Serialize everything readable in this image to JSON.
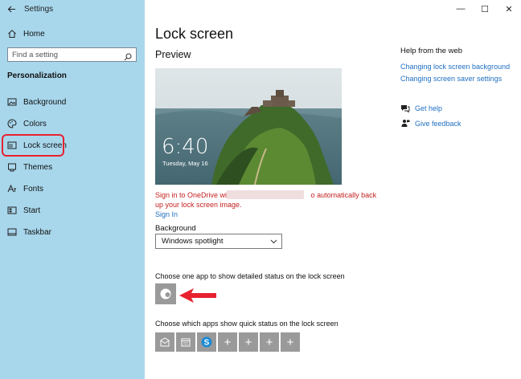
{
  "window": {
    "title": "Settings",
    "controls": {
      "minimize": "—",
      "maximize": "☐",
      "close": "✕"
    }
  },
  "sidebar": {
    "home_label": "Home",
    "search_placeholder": "Find a setting",
    "section_title": "Personalization",
    "items": [
      {
        "label": "Background",
        "icon": "image-icon"
      },
      {
        "label": "Colors",
        "icon": "palette-icon"
      },
      {
        "label": "Lock screen",
        "icon": "lock-screen-icon",
        "selected": true
      },
      {
        "label": "Themes",
        "icon": "brush-icon"
      },
      {
        "label": "Fonts",
        "icon": "fonts-icon"
      },
      {
        "label": "Start",
        "icon": "start-icon"
      },
      {
        "label": "Taskbar",
        "icon": "taskbar-icon"
      }
    ]
  },
  "main": {
    "title": "Lock screen",
    "preview_heading": "Preview",
    "preview_time": "6:40",
    "preview_date": "Tuesday, May 16",
    "onedrive_text_part1": "Sign in to OneDrive with",
    "onedrive_text_part2": "o automatically back up your lock screen image.",
    "signin_link": "Sign In",
    "background_label": "Background",
    "background_value": "Windows spotlight",
    "detailed_label": "Choose one app to show detailed status on the lock screen",
    "quick_label": "Choose which apps show quick status on the lock screen",
    "quick_apps": [
      {
        "icon": "mail-icon",
        "glyph": ""
      },
      {
        "icon": "calendar-icon",
        "glyph": ""
      },
      {
        "icon": "skype-icon",
        "glyph": ""
      },
      {
        "icon": "add-icon",
        "glyph": "+"
      },
      {
        "icon": "add-icon",
        "glyph": "+"
      },
      {
        "icon": "add-icon",
        "glyph": "+"
      },
      {
        "icon": "add-icon",
        "glyph": "+"
      }
    ]
  },
  "help": {
    "title": "Help from the web",
    "links": [
      "Changing lock screen background",
      "Changing screen saver settings"
    ],
    "get_help": "Get help",
    "give_feedback": "Give feedback"
  },
  "colors": {
    "sidebar_bg": "#a8d7ec",
    "link": "#1f6fc2",
    "error": "#c42020",
    "annotation": "#e8212f"
  }
}
